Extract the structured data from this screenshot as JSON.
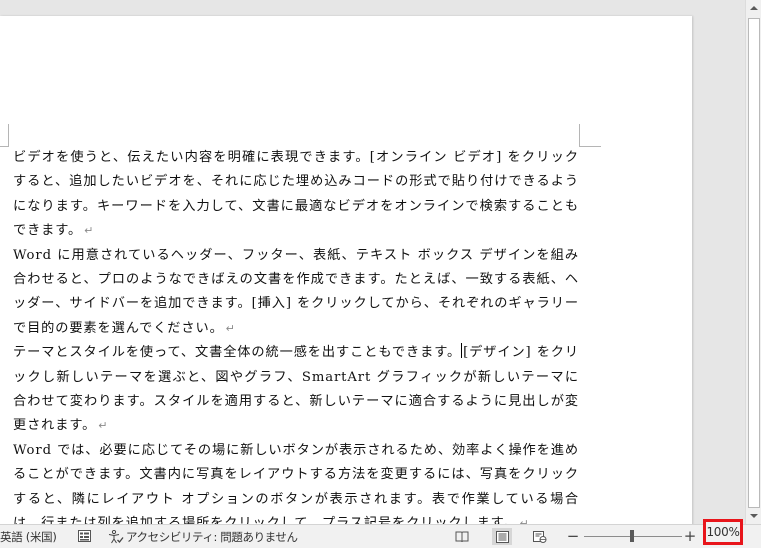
{
  "document": {
    "paragraphs": [
      {
        "text": "ビデオを使うと、伝えたい内容を明確に表現できます。[オンライン ビデオ] をクリックすると、追加したいビデオを、それに応じた埋め込みコードの形式で貼り付けできるようになります。キーワードを入力して、文書に最適なビデオをオンラインで検索することもできます。"
      },
      {
        "text": "Word に用意されているヘッダー、フッター、表紙、テキスト ボックス デザインを組み合わせると、プロのようなできばえの文書を作成できます。たとえば、一致する表紙、ヘッダー、サイドバーを追加できます。[挿入] をクリックしてから、それぞれのギャラリーで目的の要素を選んでください。"
      },
      {
        "text_before_caret": "テーマとスタイルを使って、文書全体の統一感を出すこともできます。",
        "text_after_caret": "[デザイン] をクリックし新しいテーマを選ぶと、図やグラフ、SmartArt グラフィックが新しいテーマに合わせて変わります。スタイルを適用すると、新しいテーマに適合するように見出しが変更されます。"
      },
      {
        "text": "Word では、必要に応じてその場に新しいボタンが表示されるため、効率よく操作を進めることができます。文書内に写真をレイアウトする方法を変更するには、写真をクリックすると、隣にレイアウト オプションのボタンが表示されます。表で作業している場合は、行または列を追加する場所をクリックして、プラス記号をクリックします。"
      }
    ],
    "paragraph_mark": "↵"
  },
  "statusbar": {
    "language": "英語 (米国)",
    "macro_icon": "macro-record-icon",
    "accessibility": "アクセシビリティ: 問題ありません",
    "zoom_minus": "−",
    "zoom_plus": "+",
    "zoom_level": "100%"
  },
  "colors": {
    "highlight_box": "#e8151b",
    "page": "#ffffff",
    "canvas": "#e6e6e6"
  }
}
